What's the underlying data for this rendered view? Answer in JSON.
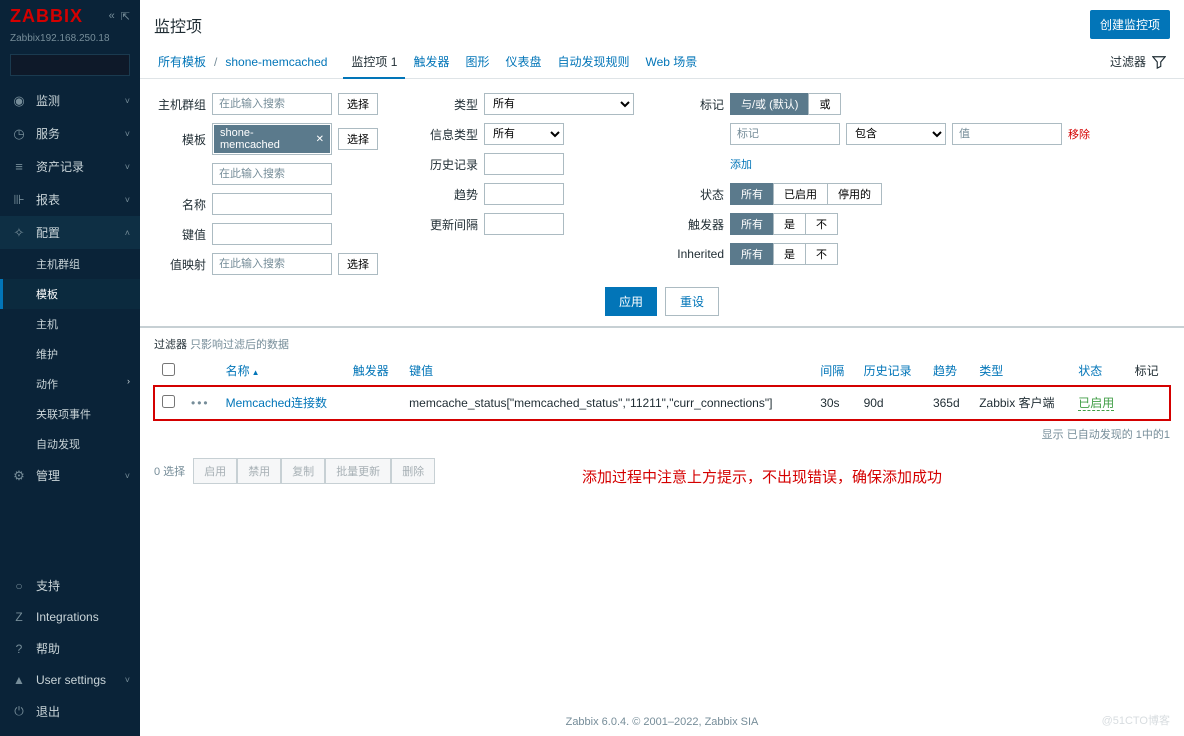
{
  "sidebar": {
    "logo": "ZABBIX",
    "server": "Zabbix192.168.250.18",
    "menu": [
      {
        "icon": "◉",
        "label": "监测",
        "chev": "˅"
      },
      {
        "icon": "◷",
        "label": "服务",
        "chev": "˅"
      },
      {
        "icon": "≡",
        "label": "资产记录",
        "chev": "˅"
      },
      {
        "icon": "⊪",
        "label": "报表",
        "chev": "˅"
      },
      {
        "icon": "✧",
        "label": "配置",
        "chev": "˄",
        "expanded": true
      }
    ],
    "submenu": [
      "主机群组",
      "模板",
      "主机",
      "维护",
      "动作",
      "关联项事件",
      "自动发现"
    ],
    "submenu_active": 1,
    "admin": {
      "icon": "⚙",
      "label": "管理",
      "chev": "˅"
    },
    "bottom": [
      {
        "icon": "○",
        "label": "支持"
      },
      {
        "icon": "Z",
        "label": "Integrations"
      },
      {
        "icon": "?",
        "label": "帮助"
      },
      {
        "icon": "▲",
        "label": "User settings",
        "chev": "˅"
      },
      {
        "icon": "⏻",
        "label": "退出"
      }
    ]
  },
  "header": {
    "title": "监控项",
    "create_btn": "创建监控项"
  },
  "breadcrumb": {
    "all_tpl": "所有模板",
    "tpl": "shone-memcached"
  },
  "tabs": [
    {
      "label": "监控项 1",
      "active": true
    },
    {
      "label": "触发器"
    },
    {
      "label": "图形"
    },
    {
      "label": "仪表盘"
    },
    {
      "label": "自动发现规则"
    },
    {
      "label": "Web 场景"
    }
  ],
  "filter_toggle": "过滤器",
  "filter": {
    "labels": {
      "hostgroup": "主机群组",
      "template": "模板",
      "name": "名称",
      "key": "键值",
      "valuemap": "值映射",
      "type": "类型",
      "infotype": "信息类型",
      "history": "历史记录",
      "trends": "趋势",
      "interval": "更新间隔",
      "tags": "标记",
      "status": "状态",
      "triggers": "触发器",
      "inherited": "Inherited"
    },
    "placeholder": "在此输入搜索",
    "select_btn": "选择",
    "template_tag": "shone-memcached",
    "type_opts": "所有",
    "infotype_opts": "所有",
    "tag_seg": {
      "andor": "与/或  (默认)",
      "or": "或"
    },
    "tag_key_ph": "标记",
    "tag_op": "包含",
    "tag_val_ph": "值",
    "tag_del": "移除",
    "tag_add": "添加",
    "status_seg": [
      "所有",
      "已启用",
      "停用的"
    ],
    "trig_seg": [
      "所有",
      "是",
      "不"
    ],
    "inh_seg": [
      "所有",
      "是",
      "不"
    ],
    "apply": "应用",
    "reset": "重设"
  },
  "filter_note": {
    "a": "过滤器",
    "b": "只影响过滤后的数据"
  },
  "table": {
    "headers": {
      "name": "名称",
      "triggers": "触发器",
      "key": "键值",
      "interval": "间隔",
      "history": "历史记录",
      "trends": "趋势",
      "type": "类型",
      "status": "状态",
      "tags": "标记"
    },
    "row": {
      "name": "Memcached连接数",
      "key": "memcache_status[\"memcached_status\",\"11211\",\"curr_connections\"]",
      "interval": "30s",
      "history": "90d",
      "trends": "365d",
      "type": "Zabbix 客户端",
      "status": "已启用"
    },
    "foot": "显示 已自动发现的 1中的1"
  },
  "bulk": {
    "count": "0 选择",
    "btns": [
      "启用",
      "禁用",
      "复制",
      "批量更新",
      "删除"
    ]
  },
  "annotation": "添加过程中注意上方提示，不出现错误，确保添加成功",
  "footer": "Zabbix 6.0.4. © 2001–2022, Zabbix SIA",
  "watermark": "@51CTO博客"
}
